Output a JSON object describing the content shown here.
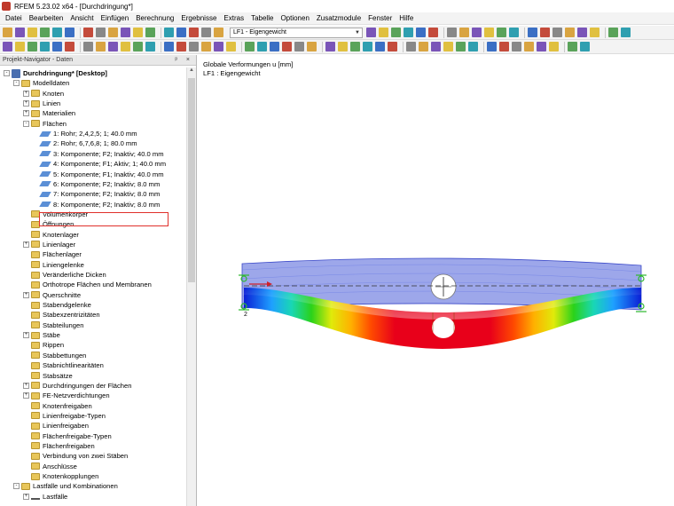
{
  "window": {
    "title": "RFEM 5.23.02 x64 - [Durchdringung*]"
  },
  "menu": [
    "Datei",
    "Bearbeiten",
    "Ansicht",
    "Einfügen",
    "Berechnung",
    "Ergebnisse",
    "Extras",
    "Tabelle",
    "Optionen",
    "Zusatzmodule",
    "Fenster",
    "Hilfe"
  ],
  "toolbar": {
    "load_case": "LF1 - Eigengewicht"
  },
  "navigator": {
    "title": "Projekt-Navigator - Daten",
    "header_buttons": "ᵖ ×",
    "tree": [
      {
        "label": "Durchdringung* [Desktop]",
        "level": 0,
        "icon": "root-icon",
        "exp": "-",
        "bold": true
      },
      {
        "label": "Modelldaten",
        "level": 1,
        "icon": "folder-icon",
        "exp": "-"
      },
      {
        "label": "Knoten",
        "level": 2,
        "icon": "folder-icon",
        "exp": "+"
      },
      {
        "label": "Linien",
        "level": 2,
        "icon": "folder-icon",
        "exp": "+"
      },
      {
        "label": "Materialien",
        "level": 2,
        "icon": "folder-icon",
        "exp": "+"
      },
      {
        "label": "Flächen",
        "level": 2,
        "icon": "folder-icon",
        "exp": "-"
      },
      {
        "label": "1: Rohr; 2,4,2,5; 1; 40.0 mm",
        "level": 3,
        "icon": "surface-icon"
      },
      {
        "label": "2: Rohr; 6,7,6,8; 1; 80.0 mm",
        "level": 3,
        "icon": "surface-icon"
      },
      {
        "label": "3: Komponente; F2; Inaktiv; 40.0 mm",
        "level": 3,
        "icon": "surface-icon"
      },
      {
        "label": "4: Komponente; F1; Aktiv; 1; 40.0 mm",
        "level": 3,
        "icon": "surface-icon"
      },
      {
        "label": "5: Komponente; F1; Inaktiv; 40.0 mm",
        "level": 3,
        "icon": "surface-icon"
      },
      {
        "label": "6: Komponente; F2; Inaktiv; 8.0 mm",
        "level": 3,
        "icon": "surface-icon"
      },
      {
        "label": "7: Komponente; F2; Inaktiv; 8.0 mm",
        "level": 3,
        "icon": "surface-icon"
      },
      {
        "label": "8: Komponente; F2; Inaktiv; 8.0 mm",
        "level": 3,
        "icon": "surface-icon"
      },
      {
        "label": "Volumenkörper",
        "level": 2,
        "icon": "folder-icon"
      },
      {
        "label": "Öffnungen",
        "level": 2,
        "icon": "folder-icon"
      },
      {
        "label": "Knotenlager",
        "level": 2,
        "icon": "folder-icon"
      },
      {
        "label": "Linienlager",
        "level": 2,
        "icon": "folder-icon",
        "exp": "+"
      },
      {
        "label": "Flächenlager",
        "level": 2,
        "icon": "folder-icon"
      },
      {
        "label": "Liniengelenke",
        "level": 2,
        "icon": "folder-icon"
      },
      {
        "label": "Veränderliche Dicken",
        "level": 2,
        "icon": "folder-icon"
      },
      {
        "label": "Orthotrope Flächen und Membranen",
        "level": 2,
        "icon": "folder-icon"
      },
      {
        "label": "Querschnitte",
        "level": 2,
        "icon": "folder-icon",
        "exp": "+"
      },
      {
        "label": "Stabendgelenke",
        "level": 2,
        "icon": "folder-icon"
      },
      {
        "label": "Stabexzentrizitäten",
        "level": 2,
        "icon": "folder-icon"
      },
      {
        "label": "Stabteilungen",
        "level": 2,
        "icon": "folder-icon"
      },
      {
        "label": "Stäbe",
        "level": 2,
        "icon": "folder-icon",
        "exp": "+"
      },
      {
        "label": "Rippen",
        "level": 2,
        "icon": "folder-icon"
      },
      {
        "label": "Stabbettungen",
        "level": 2,
        "icon": "folder-icon"
      },
      {
        "label": "Stabnichtlinearitäten",
        "level": 2,
        "icon": "folder-icon"
      },
      {
        "label": "Stabsätze",
        "level": 2,
        "icon": "folder-icon"
      },
      {
        "label": "Durchdringungen der Flächen",
        "level": 2,
        "icon": "folder-icon",
        "exp": "+"
      },
      {
        "label": "FE-Netzverdichtungen",
        "level": 2,
        "icon": "folder-icon",
        "exp": "+"
      },
      {
        "label": "Knotenfreigaben",
        "level": 2,
        "icon": "folder-icon"
      },
      {
        "label": "Linienfreigabe-Typen",
        "level": 2,
        "icon": "folder-icon"
      },
      {
        "label": "Linienfreigaben",
        "level": 2,
        "icon": "folder-icon"
      },
      {
        "label": "Flächenfreigabe-Typen",
        "level": 2,
        "icon": "folder-icon"
      },
      {
        "label": "Flächenfreigaben",
        "level": 2,
        "icon": "folder-icon"
      },
      {
        "label": "Verbindung von zwei Stäben",
        "level": 2,
        "icon": "folder-icon"
      },
      {
        "label": "Anschlüsse",
        "level": 2,
        "icon": "folder-icon"
      },
      {
        "label": "Knotenkopplungen",
        "level": 2,
        "icon": "folder-icon"
      },
      {
        "label": "Lastfälle und Kombinationen",
        "level": 1,
        "icon": "folder-icon",
        "exp": "-"
      },
      {
        "label": "Lastfälle",
        "level": 2,
        "icon": "lf-icon",
        "exp": "+"
      }
    ]
  },
  "viewport": {
    "line1": "Globale Verformungen u [mm]",
    "line2": "LF1 : Eigengewicht",
    "node_label": "2"
  },
  "colors": {
    "highlight": "#e0302a",
    "undeformed": "#4d5fd8",
    "contour": [
      "#0b1fd6",
      "#1ea0ff",
      "#19d7b4",
      "#2ad21a",
      "#e0ea0a",
      "#ffb000",
      "#ff4a00",
      "#e8001a"
    ]
  }
}
